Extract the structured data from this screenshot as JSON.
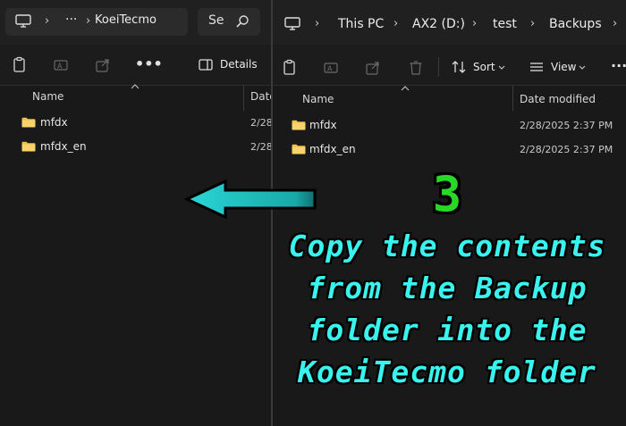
{
  "left_window": {
    "breadcrumb": {
      "more_label": "···",
      "folder": "KoeiTecmo"
    },
    "search_placeholder": "Se",
    "toolbar": {
      "details_label": "Details"
    },
    "columns": {
      "name": "Name",
      "date": "Date"
    },
    "rows": [
      {
        "name": "mfdx",
        "date": "2/28,"
      },
      {
        "name": "mfdx_en",
        "date": "2/28,"
      }
    ]
  },
  "right_window": {
    "breadcrumb": [
      "This PC",
      "AX2 (D:)",
      "test",
      "Backups"
    ],
    "toolbar": {
      "sort_label": "Sort",
      "view_label": "View",
      "more_label": "···"
    },
    "columns": {
      "name": "Name",
      "date": "Date modified"
    },
    "rows": [
      {
        "name": "mfdx",
        "date": "2/28/2025 2:37 PM"
      },
      {
        "name": "mfdx_en",
        "date": "2/28/2025 2:37 PM"
      }
    ]
  },
  "annotation": {
    "step": "3",
    "lines": [
      "Copy the contents",
      "from the Backup",
      "folder into the",
      "KoeiTecmo folder"
    ],
    "text_color": "#38f3ee",
    "step_color": "#27d827",
    "arrow_color": "#2ad6d6"
  },
  "icons": [
    "computer-icon",
    "chevron-right-icon",
    "search-icon",
    "copy-icon",
    "rename-icon",
    "share-icon",
    "delete-icon",
    "sort-icon",
    "view-icon",
    "details-pane-icon",
    "folder-icon",
    "arrow-left-icon"
  ]
}
